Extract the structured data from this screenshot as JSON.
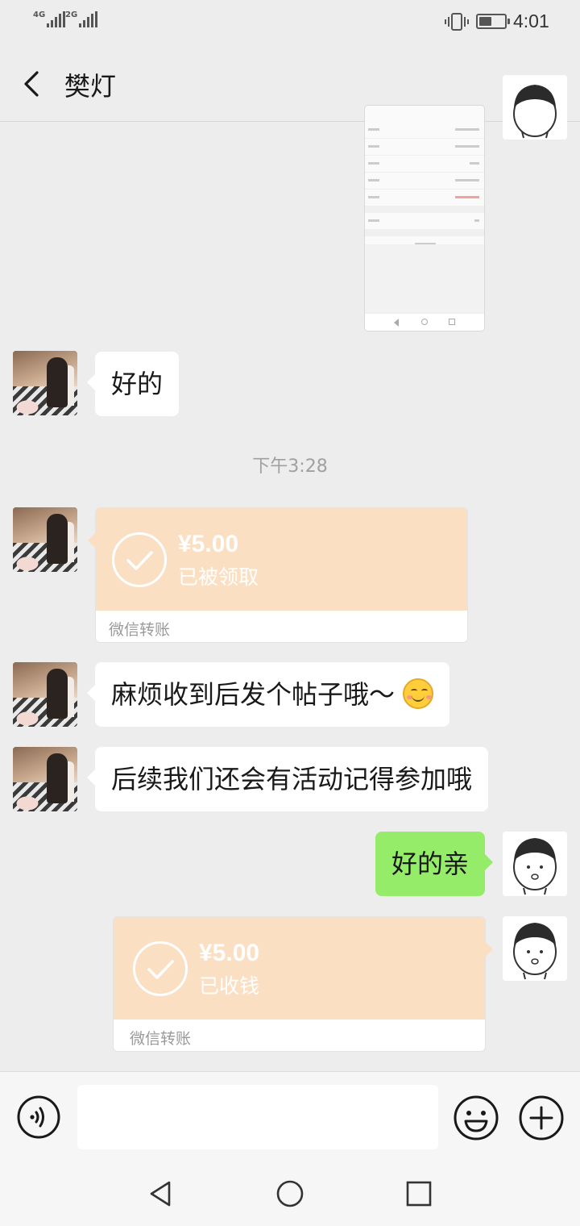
{
  "status_bar": {
    "signal1_tag": "4G",
    "signal2_tag": "2G",
    "time": "4:01",
    "icons": [
      "signal-icon",
      "signal-icon",
      "vibrate-icon",
      "battery-icon"
    ]
  },
  "header": {
    "title": "樊灯",
    "icons": [
      "back-icon",
      "more-icon"
    ]
  },
  "messages": [
    {
      "type": "image",
      "from": "me",
      "content": "profile-screenshot"
    },
    {
      "type": "text",
      "from": "other",
      "text": "好的"
    },
    {
      "type": "timestamp",
      "text": "下午3:28"
    },
    {
      "type": "transfer",
      "from": "other",
      "amount": "¥5.00",
      "status": "已被领取",
      "label": "微信转账"
    },
    {
      "type": "text",
      "from": "other",
      "text": "麻烦收到后发个帖子哦～",
      "emoji": "smiling-face-emoji"
    },
    {
      "type": "text",
      "from": "other",
      "text": "后续我们还会有活动记得参加哦"
    },
    {
      "type": "text",
      "from": "me",
      "text": "好的亲"
    },
    {
      "type": "transfer",
      "from": "me",
      "amount": "¥5.00",
      "status": "已收钱",
      "label": "微信转账"
    }
  ],
  "input_bar": {
    "message_value": "",
    "icons": [
      "voice-icon",
      "emoji-icon",
      "plus-icon"
    ]
  },
  "nav_bar": {
    "icons": [
      "back-triangle-icon",
      "home-circle-icon",
      "recents-square-icon"
    ]
  },
  "colors": {
    "background": "#ededed",
    "bubble_in": "#ffffff",
    "bubble_out": "#95ec69",
    "transfer": "#fbdfc3"
  }
}
